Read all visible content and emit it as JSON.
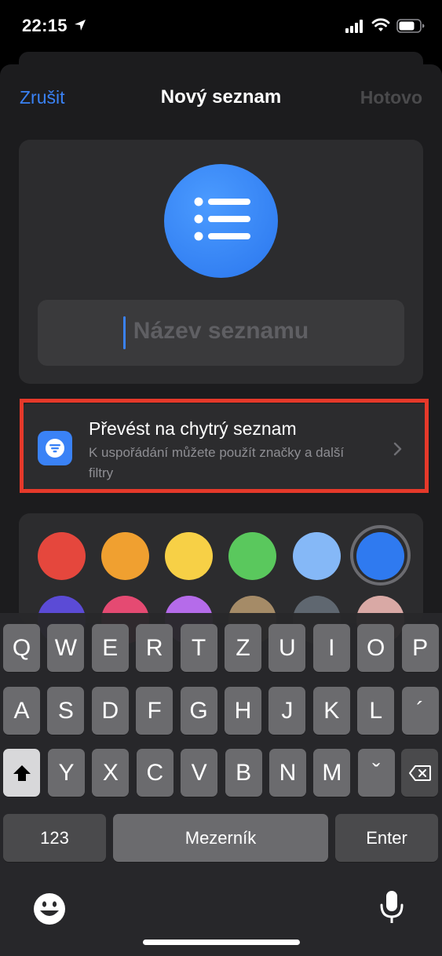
{
  "status_bar": {
    "time": "22:15"
  },
  "nav": {
    "cancel": "Zrušit",
    "title": "Nový seznam",
    "done": "Hotovo"
  },
  "list_name_field": {
    "placeholder": "Název seznamu",
    "value": ""
  },
  "smart_list": {
    "title": "Převést na chytrý seznam",
    "subtitle": "K uspořádání můžete použít značky a další filtry"
  },
  "colors": {
    "row1": [
      "#e5473d",
      "#f0a030",
      "#f7d046",
      "#5ac85d",
      "#85b8f7",
      "#2f7af0"
    ],
    "row2": [
      "#5b4bd6",
      "#e54a72",
      "#b56bea",
      "#a58b67",
      "#5f6770",
      "#d9a9a5"
    ],
    "selected": "#2f7af0"
  },
  "keyboard": {
    "row1": [
      "Q",
      "W",
      "E",
      "R",
      "T",
      "Z",
      "U",
      "I",
      "O",
      "P"
    ],
    "row2": [
      "A",
      "S",
      "D",
      "F",
      "G",
      "H",
      "J",
      "K",
      "L",
      "´"
    ],
    "row3": [
      "Y",
      "X",
      "C",
      "V",
      "B",
      "N",
      "M",
      "ˇ"
    ],
    "numbers": "123",
    "space": "Mezerník",
    "enter": "Enter"
  }
}
